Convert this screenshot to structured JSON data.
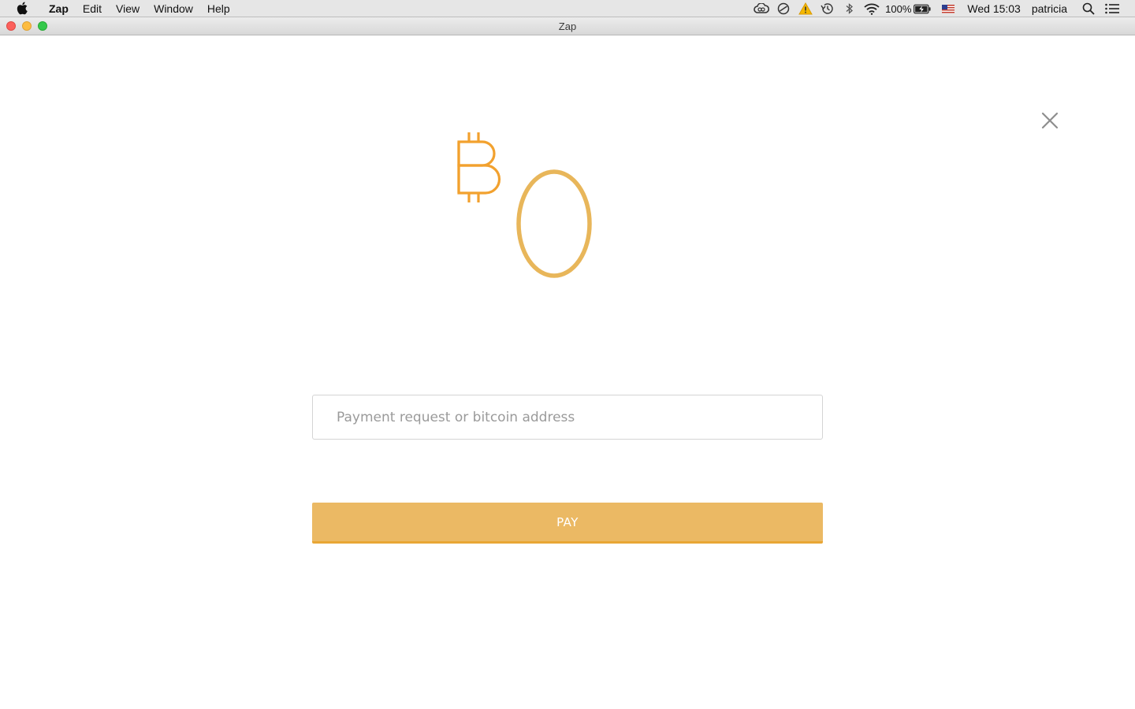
{
  "menubar": {
    "app_name": "Zap",
    "items": [
      "Edit",
      "View",
      "Window",
      "Help"
    ],
    "battery_percent": "100%",
    "clock": "Wed 15:03",
    "user": "patricia"
  },
  "window": {
    "title": "Zap"
  },
  "payment": {
    "currency_icon": "bitcoin-symbol",
    "amount": "0",
    "request_placeholder": "Payment request or bitcoin address",
    "request_value": "",
    "pay_label": "PAY"
  },
  "colors": {
    "accent": "#ebb964",
    "accent_dark": "#e8a635",
    "bitcoin_orange": "#f5a623"
  }
}
